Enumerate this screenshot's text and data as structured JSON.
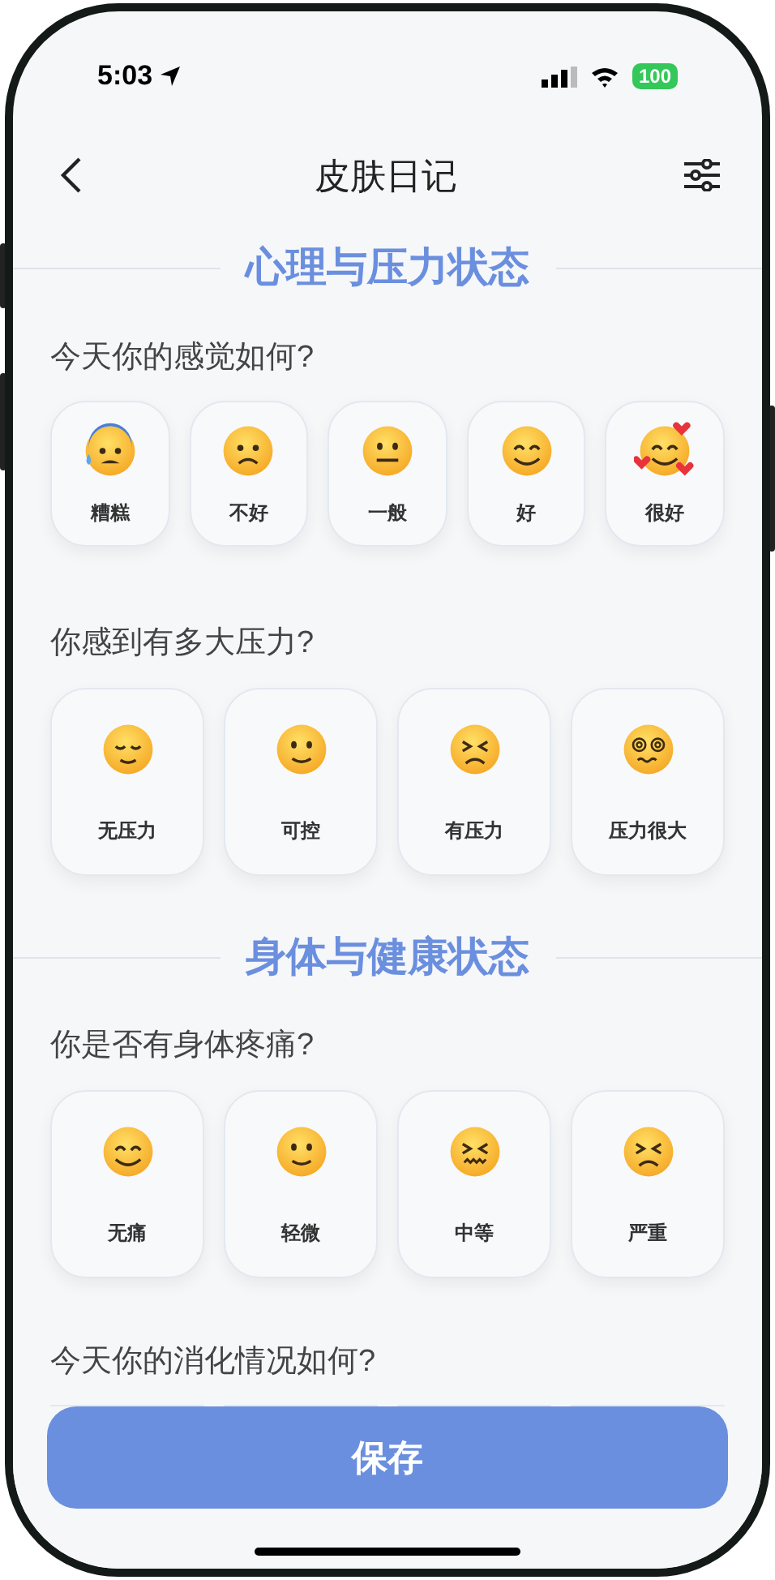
{
  "status_bar": {
    "time": "5:03",
    "battery": "100"
  },
  "nav": {
    "title": "皮肤日记"
  },
  "sections": [
    {
      "title": "心理与压力状态",
      "questions": [
        {
          "text": "今天你的感觉如何?",
          "options": [
            {
              "label": "糟糕",
              "kind": "sweat"
            },
            {
              "label": "不好",
              "kind": "worried"
            },
            {
              "label": "一般",
              "kind": "neutral"
            },
            {
              "label": "好",
              "kind": "smiling"
            },
            {
              "label": "很好",
              "kind": "hearts"
            }
          ]
        },
        {
          "text": "你感到有多大压力?",
          "options": [
            {
              "label": "无压力",
              "kind": "relieved"
            },
            {
              "label": "可控",
              "kind": "slight"
            },
            {
              "label": "有压力",
              "kind": "squint"
            },
            {
              "label": "压力很大",
              "kind": "dizzy"
            }
          ]
        }
      ]
    },
    {
      "title": "身体与健康状态",
      "questions": [
        {
          "text": "你是否有身体疼痛?",
          "options": [
            {
              "label": "无痛",
              "kind": "smiling"
            },
            {
              "label": "轻微",
              "kind": "slight"
            },
            {
              "label": "中等",
              "kind": "confounded"
            },
            {
              "label": "严重",
              "kind": "squint"
            }
          ]
        },
        {
          "text": "今天你的消化情况如何?"
        }
      ]
    }
  ],
  "save_button": {
    "label": "保存"
  }
}
